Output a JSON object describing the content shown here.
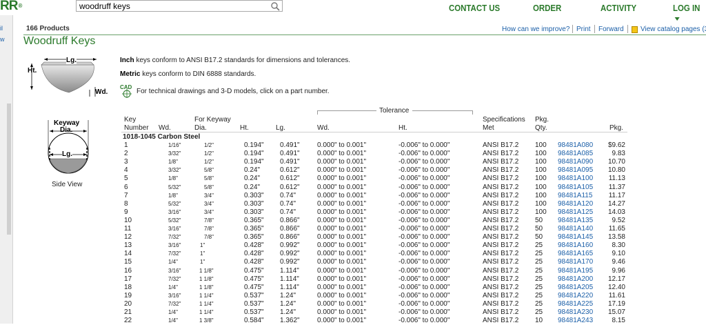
{
  "header": {
    "logo": "RR",
    "logo_mark": "®",
    "search_value": "woodruff keys",
    "nav": [
      {
        "label": "CONTACT US"
      },
      {
        "label": "ORDER"
      },
      {
        "label": "ACTIVITY"
      },
      {
        "label": "LOG IN"
      }
    ]
  },
  "left_rail": {
    "marks": [
      "il",
      "w"
    ]
  },
  "subheader": {
    "count": "166 Products",
    "tools": [
      "How can we improve?",
      "Print",
      "Forward",
      "View catalog pages (3"
    ],
    "title": "Woodruff Keys"
  },
  "diagrams": {
    "top": {
      "length": "Lg.",
      "height": "Ht.",
      "width": "Wd."
    },
    "side": {
      "keyway": "Keyway",
      "dia": "Dia.",
      "length": "Lg.",
      "caption": "Side View"
    }
  },
  "intro": {
    "inch_bold": "Inch",
    "inch_rest": " keys conform to ANSI B17.2 standards for dimensions and tolerances.",
    "metric_bold": "Metric",
    "metric_rest": " keys conform to DIN 6888 standards.",
    "cad_label": "CAD",
    "cad_text": "For technical drawings and 3-D models, click on a part number."
  },
  "table": {
    "tolerance_label": "Tolerance",
    "headers": {
      "key": "Key",
      "number": "Number",
      "wd": "Wd.",
      "for_keyway": "For Keyway",
      "dia": "Dia.",
      "ht": "Ht.",
      "lg": "Lg.",
      "tol_wd": "Wd.",
      "tol_ht": "Ht.",
      "spec": "Specifications",
      "met": "Met",
      "pkg_qty_1": "Pkg.",
      "pkg_qty_2": "Qty.",
      "pkg": "Pkg."
    },
    "group": "1018-1045 Carbon Steel",
    "rows": [
      {
        "key": "1",
        "wd": "1/16\"",
        "dia": "1/2\"",
        "ht": "0.194\"",
        "lg": "0.491\"",
        "twd": "0.000\" to 0.001\"",
        "tht": "-0.006\" to 0.000\"",
        "spec": "ANSI B17.2",
        "qty": "100",
        "part": "98481A080",
        "price": "$9.62"
      },
      {
        "key": "2",
        "wd": "3/32\"",
        "dia": "1/2\"",
        "ht": "0.194\"",
        "lg": "0.491\"",
        "twd": "0.000\" to 0.001\"",
        "tht": "-0.006\" to 0.000\"",
        "spec": "ANSI B17.2",
        "qty": "100",
        "part": "98481A085",
        "price": "9.83"
      },
      {
        "key": "3",
        "wd": "1/8\"",
        "dia": "1/2\"",
        "ht": "0.194\"",
        "lg": "0.491\"",
        "twd": "0.000\" to 0.001\"",
        "tht": "-0.006\" to 0.000\"",
        "spec": "ANSI B17.2",
        "qty": "100",
        "part": "98481A090",
        "price": "10.70"
      },
      {
        "key": "4",
        "wd": "3/32\"",
        "dia": "5/8\"",
        "ht": "0.24\"",
        "lg": "0.612\"",
        "twd": "0.000\" to 0.001\"",
        "tht": "-0.006\" to 0.000\"",
        "spec": "ANSI B17.2",
        "qty": "100",
        "part": "98481A095",
        "price": "10.80"
      },
      {
        "key": "5",
        "wd": "1/8\"",
        "dia": "5/8\"",
        "ht": "0.24\"",
        "lg": "0.612\"",
        "twd": "0.000\" to 0.001\"",
        "tht": "-0.006\" to 0.000\"",
        "spec": "ANSI B17.2",
        "qty": "100",
        "part": "98481A100",
        "price": "11.13"
      },
      {
        "key": "6",
        "wd": "5/32\"",
        "dia": "5/8\"",
        "ht": "0.24\"",
        "lg": "0.612\"",
        "twd": "0.000\" to 0.001\"",
        "tht": "-0.006\" to 0.000\"",
        "spec": "ANSI B17.2",
        "qty": "100",
        "part": "98481A105",
        "price": "11.37"
      },
      {
        "key": "7",
        "wd": "1/8\"",
        "dia": "3/4\"",
        "ht": "0.303\"",
        "lg": "0.74\"",
        "twd": "0.000\" to 0.001\"",
        "tht": "-0.006\" to 0.000\"",
        "spec": "ANSI B17.2",
        "qty": "100",
        "part": "98481A115",
        "price": "11.17"
      },
      {
        "key": "8",
        "wd": "5/32\"",
        "dia": "3/4\"",
        "ht": "0.303\"",
        "lg": "0.74\"",
        "twd": "0.000\" to 0.001\"",
        "tht": "-0.006\" to 0.000\"",
        "spec": "ANSI B17.2",
        "qty": "100",
        "part": "98481A120",
        "price": "14.27"
      },
      {
        "key": "9",
        "wd": "3/16\"",
        "dia": "3/4\"",
        "ht": "0.303\"",
        "lg": "0.74\"",
        "twd": "0.000\" to 0.001\"",
        "tht": "-0.006\" to 0.000\"",
        "spec": "ANSI B17.2",
        "qty": "100",
        "part": "98481A125",
        "price": "14.03"
      },
      {
        "key": "10",
        "wd": "5/32\"",
        "dia": "7/8\"",
        "ht": "0.365\"",
        "lg": "0.866\"",
        "twd": "0.000\" to 0.001\"",
        "tht": "-0.006\" to 0.000\"",
        "spec": "ANSI B17.2",
        "qty": "50",
        "part": "98481A135",
        "price": "9.52"
      },
      {
        "key": "11",
        "wd": "3/16\"",
        "dia": "7/8\"",
        "ht": "0.365\"",
        "lg": "0.866\"",
        "twd": "0.000\" to 0.001\"",
        "tht": "-0.006\" to 0.000\"",
        "spec": "ANSI B17.2",
        "qty": "50",
        "part": "98481A140",
        "price": "11.65"
      },
      {
        "key": "12",
        "wd": "7/32\"",
        "dia": "7/8\"",
        "ht": "0.365\"",
        "lg": "0.866\"",
        "twd": "0.000\" to 0.001\"",
        "tht": "-0.006\" to 0.000\"",
        "spec": "ANSI B17.2",
        "qty": "50",
        "part": "98481A145",
        "price": "13.58"
      },
      {
        "key": "13",
        "wd": "3/16\"",
        "dia": "1\"",
        "ht": "0.428\"",
        "lg": "0.992\"",
        "twd": "0.000\" to 0.001\"",
        "tht": "-0.006\" to 0.000\"",
        "spec": "ANSI B17.2",
        "qty": "25",
        "part": "98481A160",
        "price": "8.30"
      },
      {
        "key": "14",
        "wd": "7/32\"",
        "dia": "1\"",
        "ht": "0.428\"",
        "lg": "0.992\"",
        "twd": "0.000\" to 0.001\"",
        "tht": "-0.006\" to 0.000\"",
        "spec": "ANSI B17.2",
        "qty": "25",
        "part": "98481A165",
        "price": "9.10"
      },
      {
        "key": "15",
        "wd": "1/4\"",
        "dia": "1\"",
        "ht": "0.428\"",
        "lg": "0.992\"",
        "twd": "0.000\" to 0.001\"",
        "tht": "-0.006\" to 0.000\"",
        "spec": "ANSI B17.2",
        "qty": "25",
        "part": "98481A170",
        "price": "9.46"
      },
      {
        "key": "16",
        "wd": "3/16\"",
        "dia": "1 1/8\"",
        "ht": "0.475\"",
        "lg": "1.114\"",
        "twd": "0.000\" to 0.001\"",
        "tht": "-0.006\" to 0.000\"",
        "spec": "ANSI B17.2",
        "qty": "25",
        "part": "98481A195",
        "price": "9.96"
      },
      {
        "key": "17",
        "wd": "7/32\"",
        "dia": "1 1/8\"",
        "ht": "0.475\"",
        "lg": "1.114\"",
        "twd": "0.000\" to 0.001\"",
        "tht": "-0.006\" to 0.000\"",
        "spec": "ANSI B17.2",
        "qty": "25",
        "part": "98481A200",
        "price": "12.17"
      },
      {
        "key": "18",
        "wd": "1/4\"",
        "dia": "1 1/8\"",
        "ht": "0.475\"",
        "lg": "1.114\"",
        "twd": "0.000\" to 0.001\"",
        "tht": "-0.006\" to 0.000\"",
        "spec": "ANSI B17.2",
        "qty": "25",
        "part": "98481A205",
        "price": "12.40"
      },
      {
        "key": "19",
        "wd": "3/16\"",
        "dia": "1 1/4\"",
        "ht": "0.537\"",
        "lg": "1.24\"",
        "twd": "0.000\" to 0.001\"",
        "tht": "-0.006\" to 0.000\"",
        "spec": "ANSI B17.2",
        "qty": "25",
        "part": "98481A220",
        "price": "11.61"
      },
      {
        "key": "20",
        "wd": "7/32\"",
        "dia": "1 1/4\"",
        "ht": "0.537\"",
        "lg": "1.24\"",
        "twd": "0.000\" to 0.001\"",
        "tht": "-0.006\" to 0.000\"",
        "spec": "ANSI B17.2",
        "qty": "25",
        "part": "98481A225",
        "price": "17.19"
      },
      {
        "key": "21",
        "wd": "1/4\"",
        "dia": "1 1/4\"",
        "ht": "0.537\"",
        "lg": "1.24\"",
        "twd": "0.000\" to 0.001\"",
        "tht": "-0.006\" to 0.000\"",
        "spec": "ANSI B17.2",
        "qty": "25",
        "part": "98481A230",
        "price": "15.07"
      },
      {
        "key": "22",
        "wd": "1/4\"",
        "dia": "1 3/8\"",
        "ht": "0.584\"",
        "lg": "1.362\"",
        "twd": "0.000\" to 0.001\"",
        "tht": "-0.006\" to 0.000\"",
        "spec": "ANSI B17.2",
        "qty": "10",
        "part": "98481A243",
        "price": "8.15"
      }
    ]
  }
}
